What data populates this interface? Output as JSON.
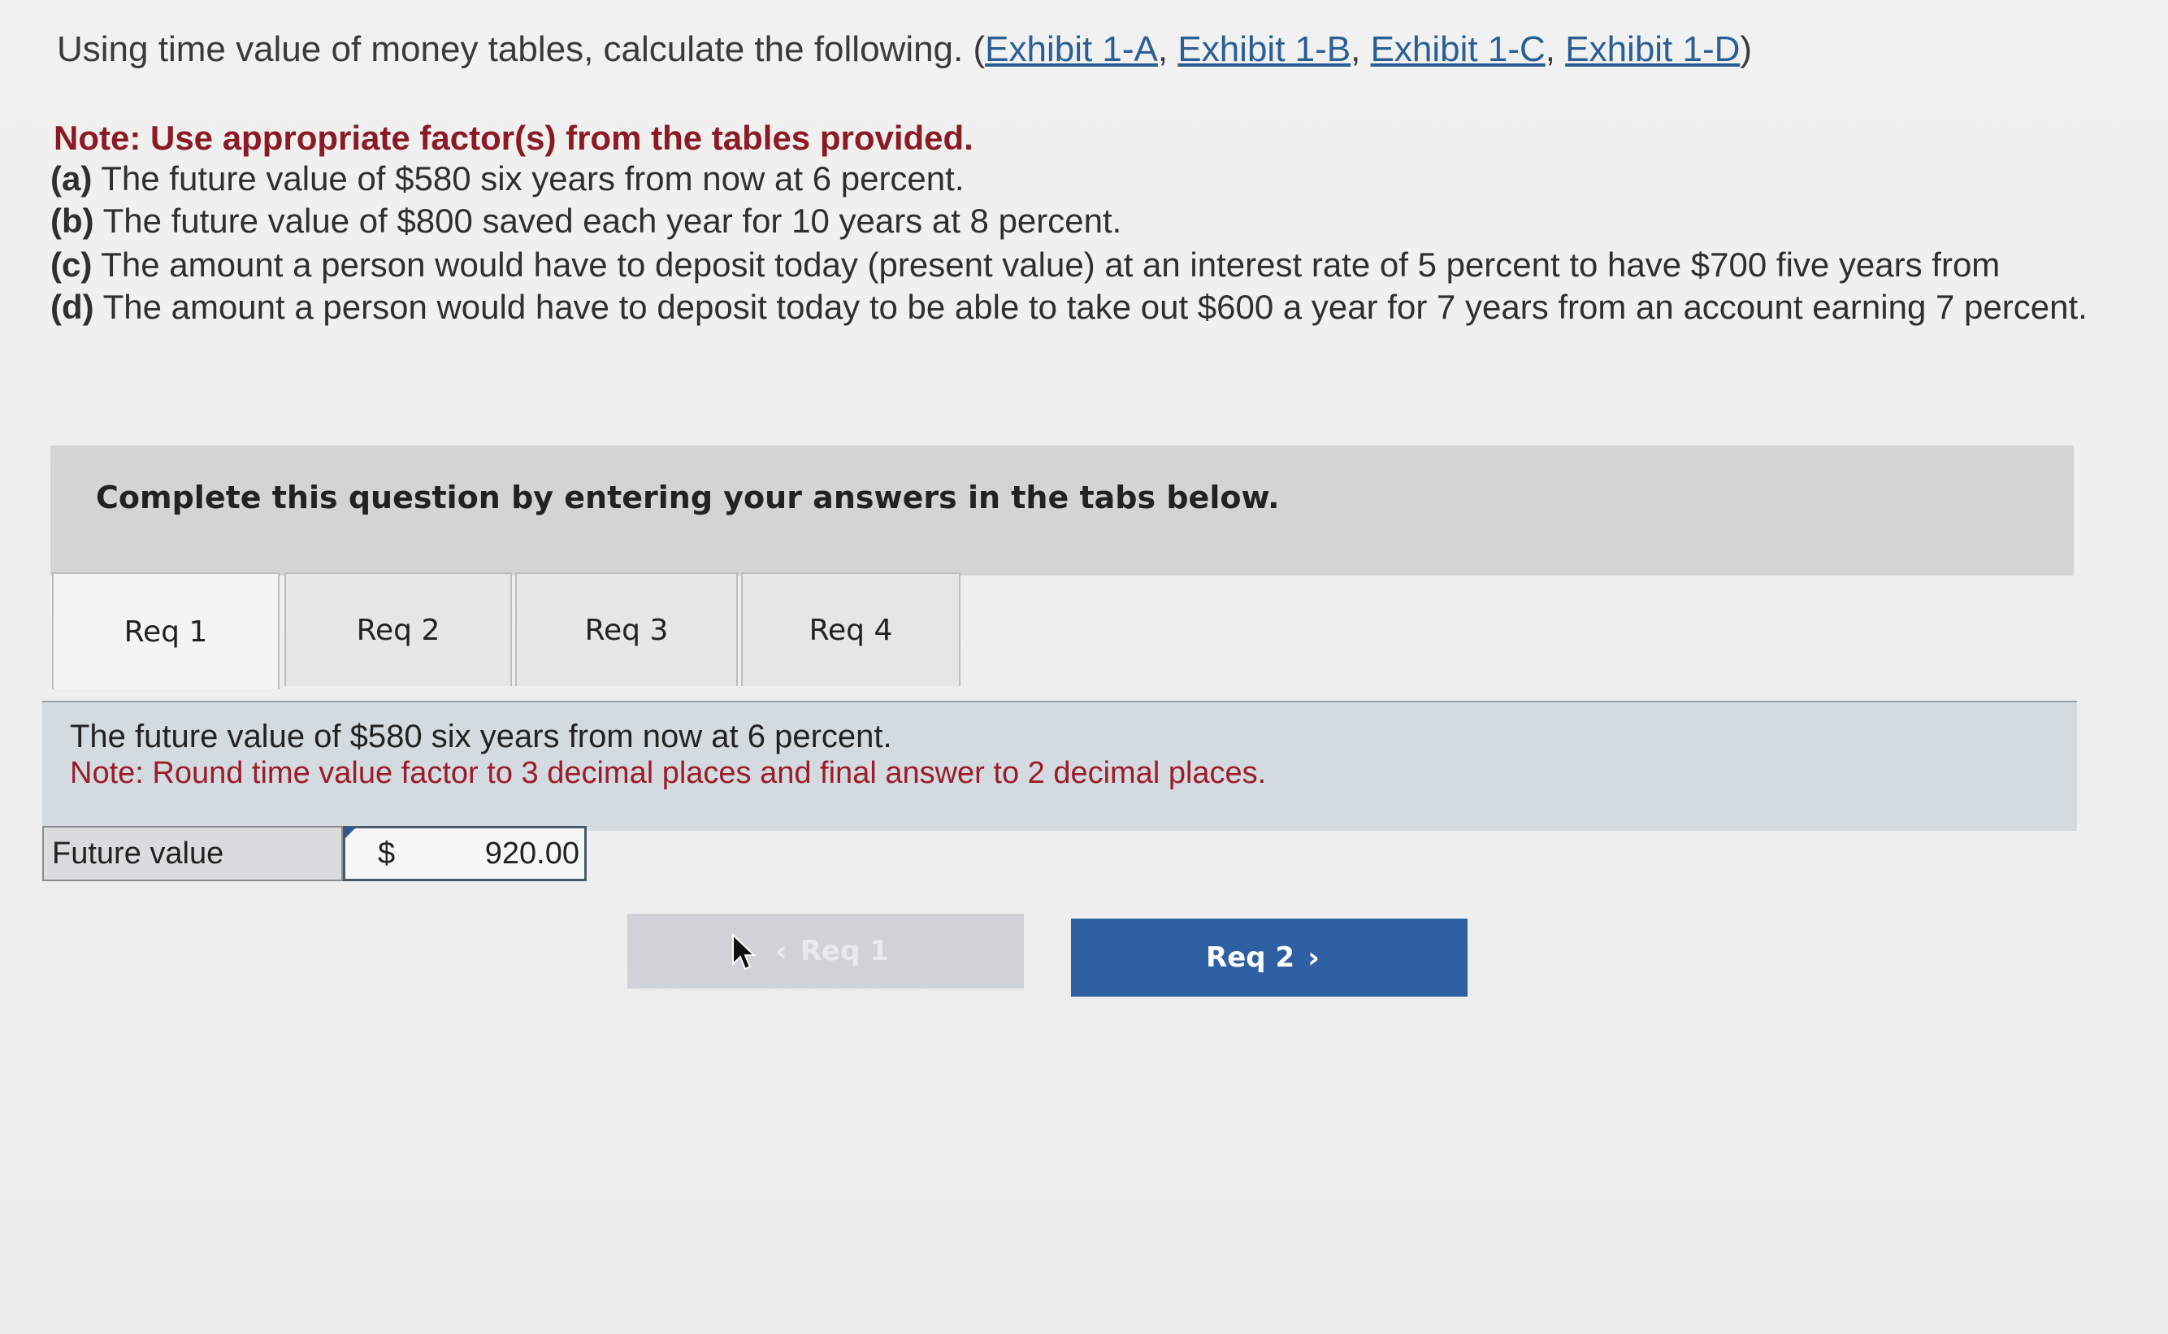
{
  "question": {
    "intro": "Using time value of money tables, calculate the following. (",
    "exhibits": [
      "Exhibit 1-A",
      "Exhibit 1-B",
      "Exhibit 1-C",
      "Exhibit 1-D"
    ],
    "intro_close": ")",
    "note": "Note: Use appropriate factor(s) from the tables provided.",
    "parts": [
      {
        "letter": "(a)",
        "text": "The future value of $580 six years from now at 6 percent."
      },
      {
        "letter": "(b)",
        "text": "The future value of $800 saved each year for 10 years at 8 percent."
      },
      {
        "letter": "(c)",
        "text": "The amount a person would have to deposit today (present value) at an interest rate of 5 percent to have $700 five years from"
      },
      {
        "letter": "(d)",
        "text": "The amount a person would have to deposit today to be able to take out $600 a year for 7 years from an account earning 7 percent."
      }
    ]
  },
  "banner": {
    "text": "Complete this question by entering your answers in the tabs below."
  },
  "tabs": [
    {
      "label": "Req 1",
      "active": true
    },
    {
      "label": "Req 2",
      "active": false
    },
    {
      "label": "Req 3",
      "active": false
    },
    {
      "label": "Req 4",
      "active": false
    }
  ],
  "panel": {
    "description": "The future value of $580 six years from now at 6 percent.",
    "instruction": "Note: Round time value factor to 3 decimal places and final answer to 2 decimal places."
  },
  "answer": {
    "label": "Future value",
    "currency": "$",
    "value": "920.00"
  },
  "nav": {
    "prev_label": "Req 1",
    "next_label": "Req 2",
    "prev_icon": "chevron-left-icon",
    "next_icon": "chevron-right-icon"
  },
  "colors": {
    "note_red": "#8c1a24",
    "link_blue": "#2a5f95",
    "primary_button": "#2e5fa2",
    "disabled_button": "#cfd3d8"
  }
}
